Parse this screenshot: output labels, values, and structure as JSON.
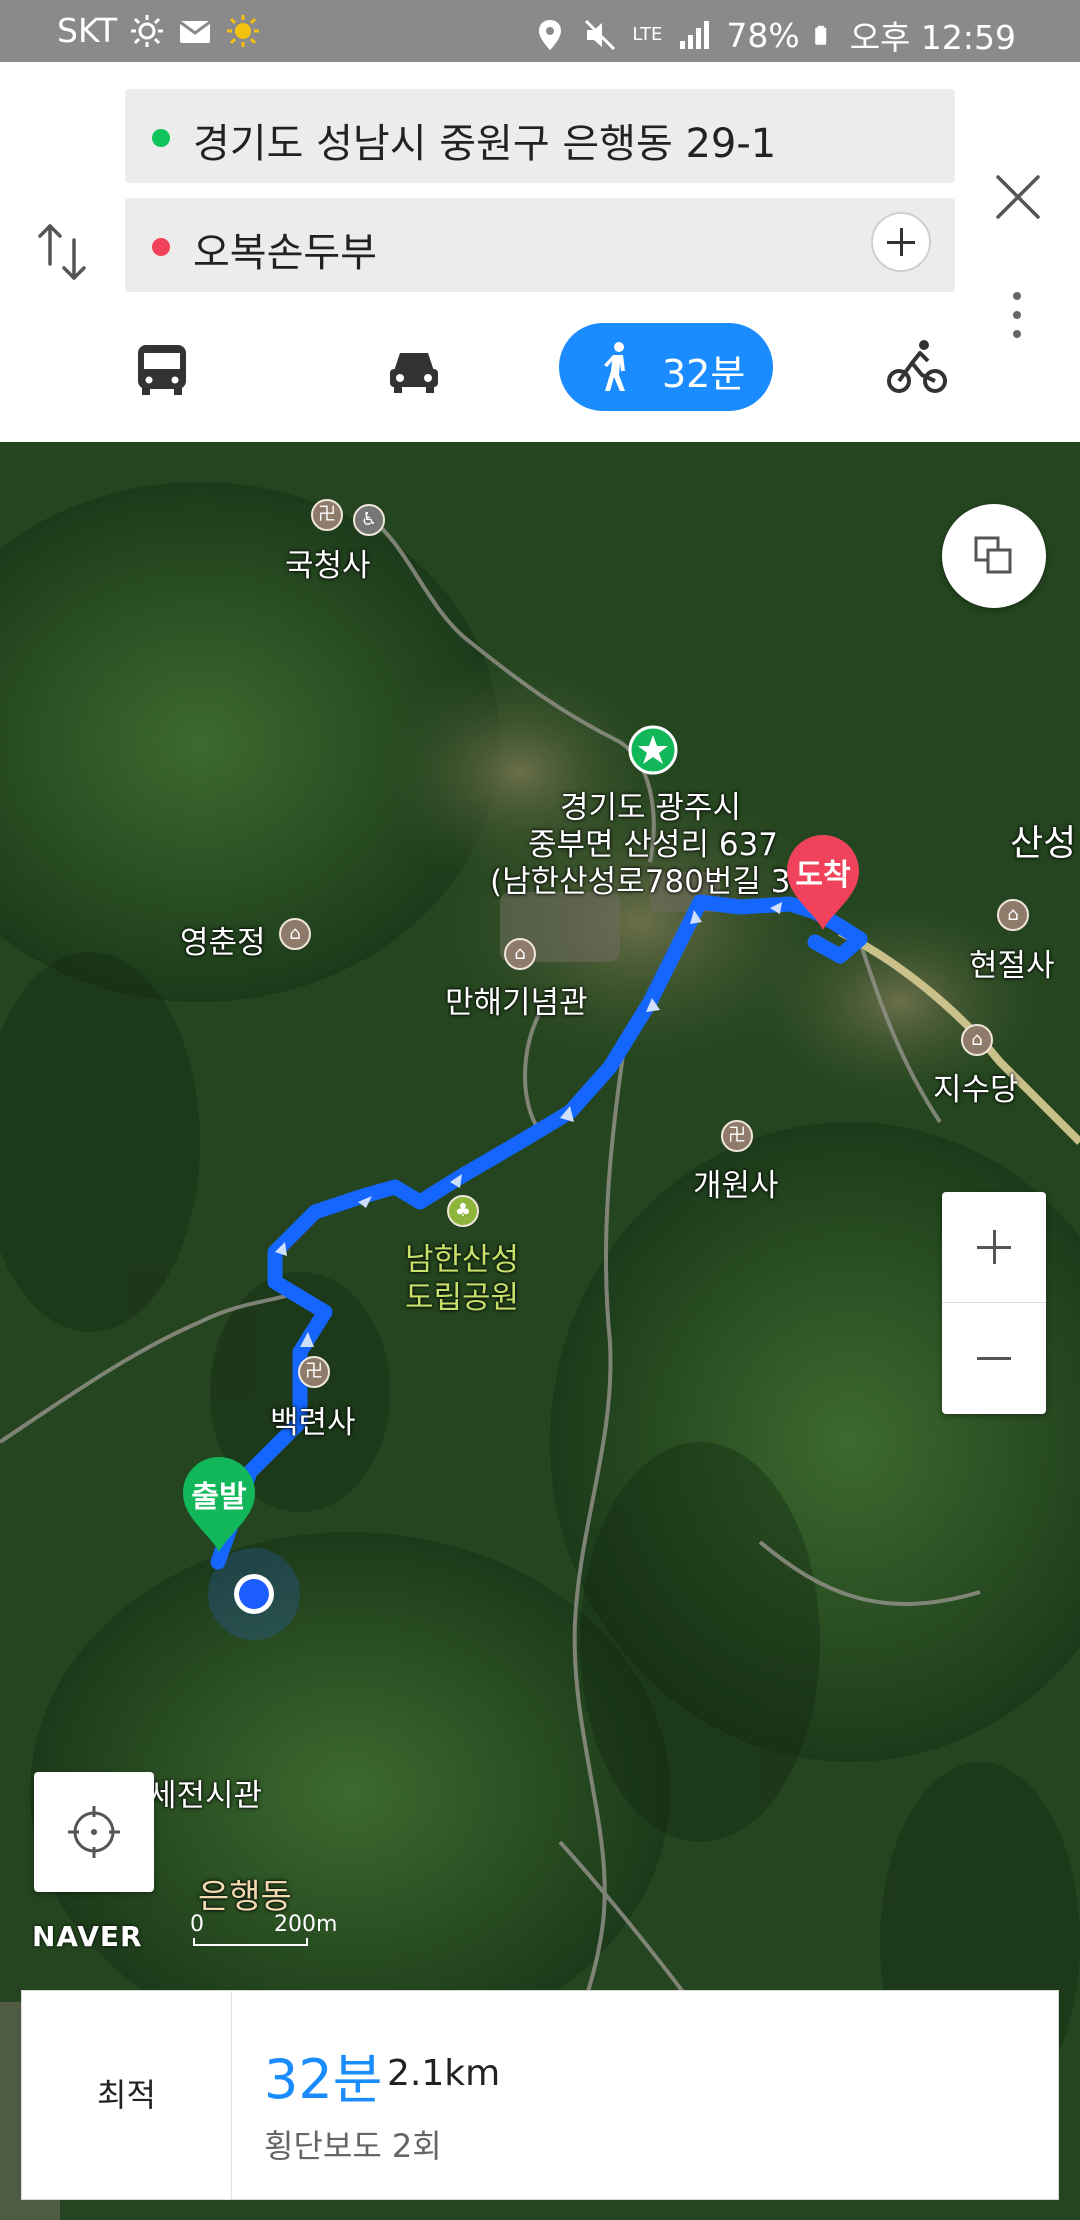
{
  "status_bar": {
    "carrier": "SKT",
    "network": "LTE",
    "battery": "78%",
    "time": "오후 12:59",
    "icons": [
      "brightness-icon",
      "mail-icon",
      "sun-icon",
      "location-icon",
      "mute-icon",
      "signal-icon",
      "battery-icon"
    ]
  },
  "route": {
    "start": "경기도 성남시 중원구 은행동 29-1",
    "goal": "오복손두부",
    "start_dot_color": "#10c35a",
    "goal_dot_color": "#f0425a"
  },
  "modes": {
    "selected": "walk",
    "walk_time": "32분",
    "accent": "#1a8cff"
  },
  "map": {
    "labels": {
      "gukcheongsa": "국청사",
      "dest_line1": "경기도 광주시",
      "dest_line2": "중부면 산성리 637",
      "dest_line3": "(남한산성로780번길 3",
      "sanseong": "산성",
      "yeongchunjeong": "영춘정",
      "manhae": "만해기념관",
      "hyeonjeolsa": "현절사",
      "jisudang": "지수당",
      "gaewonsa": "개원사",
      "park_line1": "남한산성",
      "park_line2": "도립공원",
      "baekryeonsa": "백련사",
      "jeonsigwan": "세전시관",
      "eunhaengdong": "은행동"
    },
    "start_marker": "출발",
    "goal_marker": "도착",
    "logo": "NAVER",
    "scale_zero": "0",
    "scale_distance": "200m"
  },
  "result": {
    "tag": "최적",
    "time": "32분",
    "distance": "2.1km",
    "crosswalks": "횡단보도 2회"
  }
}
